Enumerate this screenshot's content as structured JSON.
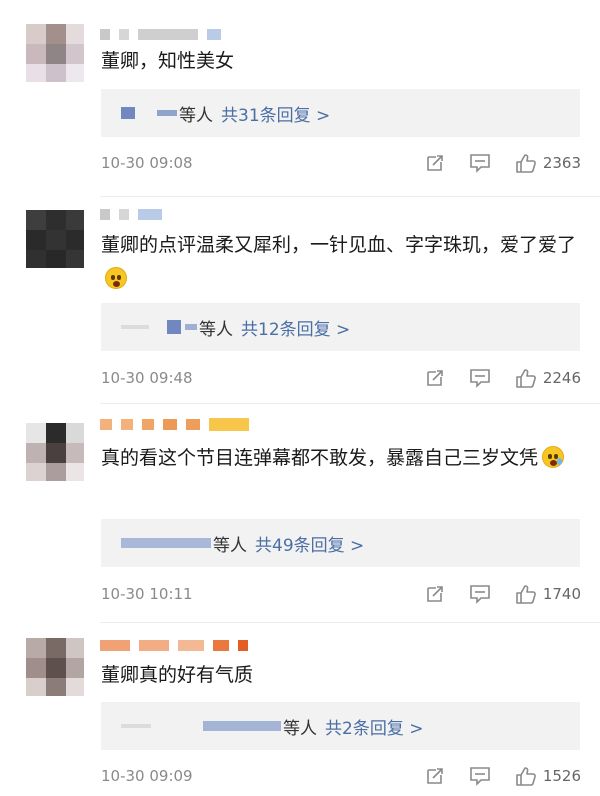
{
  "comments": [
    {
      "text": "董卿，知性美女",
      "reply_who": "等人",
      "reply_total": "共31条回复 >",
      "time": "10-30 09:08",
      "likes": "2363"
    },
    {
      "text": "董卿的点评温柔又犀利，一针见血、字字珠玑，爱了爱了",
      "emoji": "heart-eyes-emoji",
      "reply_who": "等人",
      "reply_total": "共12条回复 >",
      "time": "10-30 09:48",
      "likes": "2246"
    },
    {
      "text": "真的看这个节目连弹幕都不敢发，暴露自己三岁文凭",
      "emoji": "crying-emoji",
      "reply_who": "等人",
      "reply_total": "共49条回复 >",
      "time": "10-30 10:11",
      "likes": "1740"
    },
    {
      "text": "董卿真的好有气质",
      "reply_who": "等人",
      "reply_total": "共2条回复 >",
      "time": "10-30 09:09",
      "likes": "1526"
    }
  ],
  "icons": {
    "share": "share-icon",
    "comment": "comment-icon",
    "like": "thumbs-up-icon"
  },
  "colors": {
    "link": "#4a6fa5",
    "meta": "#8a8a8a",
    "reply_bg": "#f2f2f2"
  }
}
